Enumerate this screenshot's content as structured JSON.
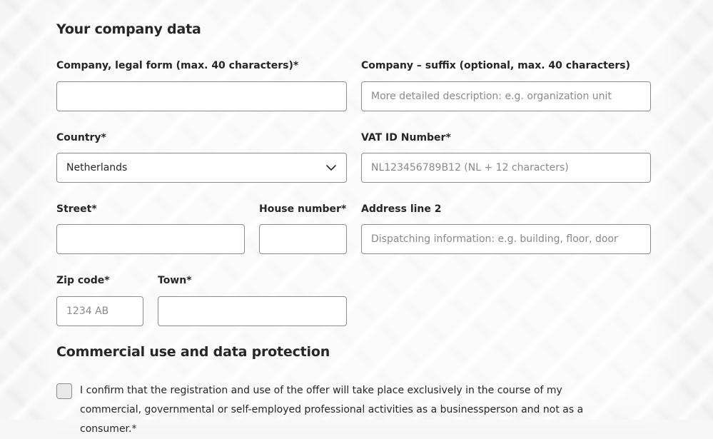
{
  "section_company": {
    "title": "Your company data",
    "company": {
      "label": "Company, legal form (max. 40 characters)*",
      "value": "",
      "placeholder": ""
    },
    "company_suffix": {
      "label": "Company – suffix (optional, max. 40 characters)",
      "value": "",
      "placeholder": "More detailed description: e.g. organization unit"
    },
    "country": {
      "label": "Country*",
      "value": "Netherlands",
      "icon": "chevron-down-icon"
    },
    "vat": {
      "label": "VAT ID Number*",
      "value": "",
      "placeholder": "NL123456789B12 (NL + 12 characters)"
    },
    "street": {
      "label": "Street*",
      "value": "",
      "placeholder": ""
    },
    "house_number": {
      "label": "House number*",
      "value": "",
      "placeholder": ""
    },
    "address_line2": {
      "label": "Address line 2",
      "value": "",
      "placeholder": "Dispatching information: e.g. building, floor, door"
    },
    "zip": {
      "label": "Zip code*",
      "value": "",
      "placeholder": "1234 AB"
    },
    "town": {
      "label": "Town*",
      "value": "",
      "placeholder": ""
    }
  },
  "section_commercial": {
    "title": "Commercial use and data protection",
    "consent": {
      "checked": false,
      "text": "I confirm that the registration and use of the offer will take place exclusively in the course of my commercial, governmental or self-employed professional activities as a businessperson and not as a consumer.*"
    }
  },
  "colors": {
    "text": "#262626",
    "border": "#8c8c8c",
    "placeholder": "#8a8a8a",
    "checkbox_fill": "#e9e9e9"
  }
}
